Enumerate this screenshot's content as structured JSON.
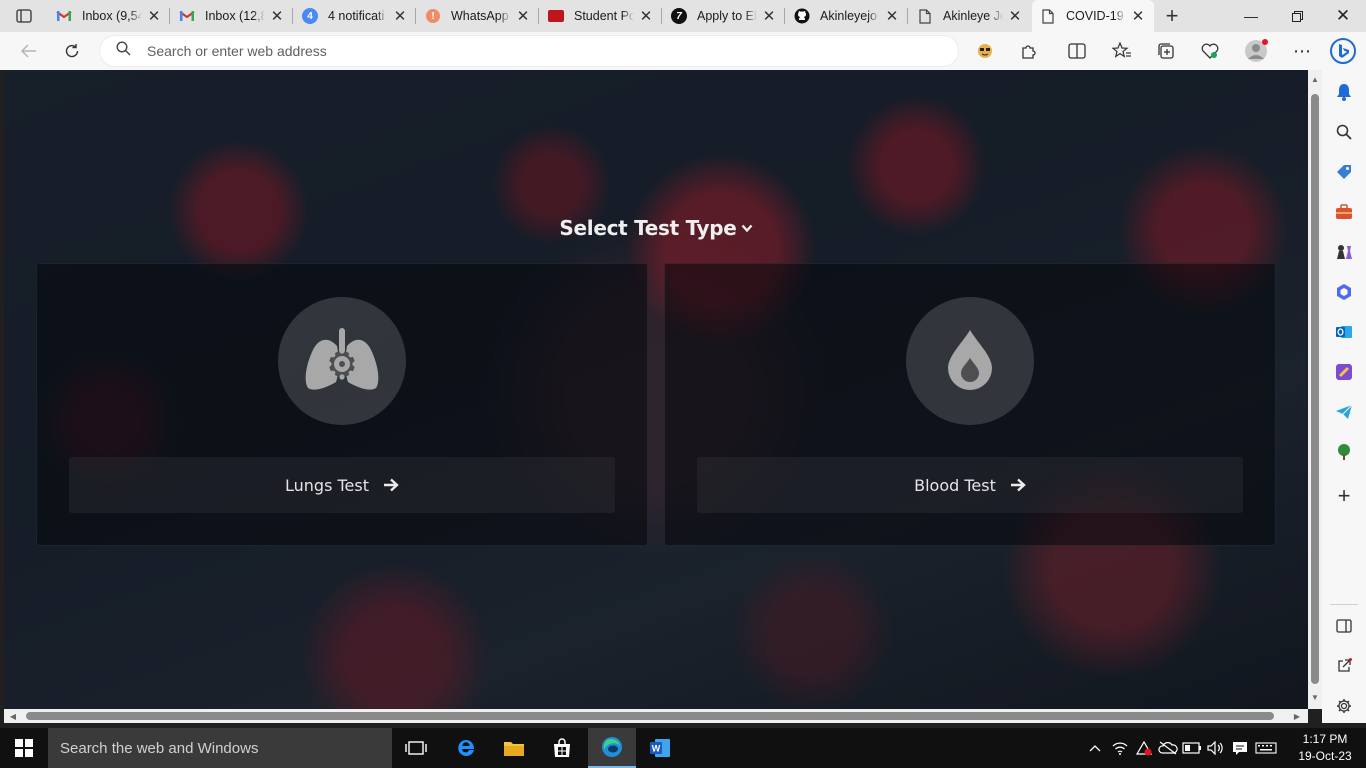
{
  "browser": {
    "tabs": [
      {
        "title": "Inbox (9,54",
        "icon": "gmail-icon"
      },
      {
        "title": "Inbox (12,8",
        "icon": "gmail-icon"
      },
      {
        "title": "4 notificati",
        "icon": "notification-badge-icon",
        "badge": "4"
      },
      {
        "title": "WhatsApp",
        "icon": "whatsapp-icon"
      },
      {
        "title": "Student Po",
        "icon": "student-portal-icon"
      },
      {
        "title": "Apply to El",
        "icon": "apply-icon"
      },
      {
        "title": "Akinleyejo",
        "icon": "github-icon"
      },
      {
        "title": "Akinleye Jo",
        "icon": "page-icon"
      },
      {
        "title": "COVID-19",
        "icon": "page-icon",
        "active": true
      }
    ],
    "address_placeholder": "Search or enter web address",
    "accent_color": "#0078d4"
  },
  "page": {
    "heading": "Select Test Type",
    "cards": [
      {
        "label": "Lungs Test",
        "icon": "lungs-icon"
      },
      {
        "label": "Blood Test",
        "icon": "blood-drop-icon"
      }
    ]
  },
  "taskbar": {
    "search_placeholder": "Search the web and Windows",
    "time": "1:17 PM",
    "date": "19-Oct-23"
  }
}
